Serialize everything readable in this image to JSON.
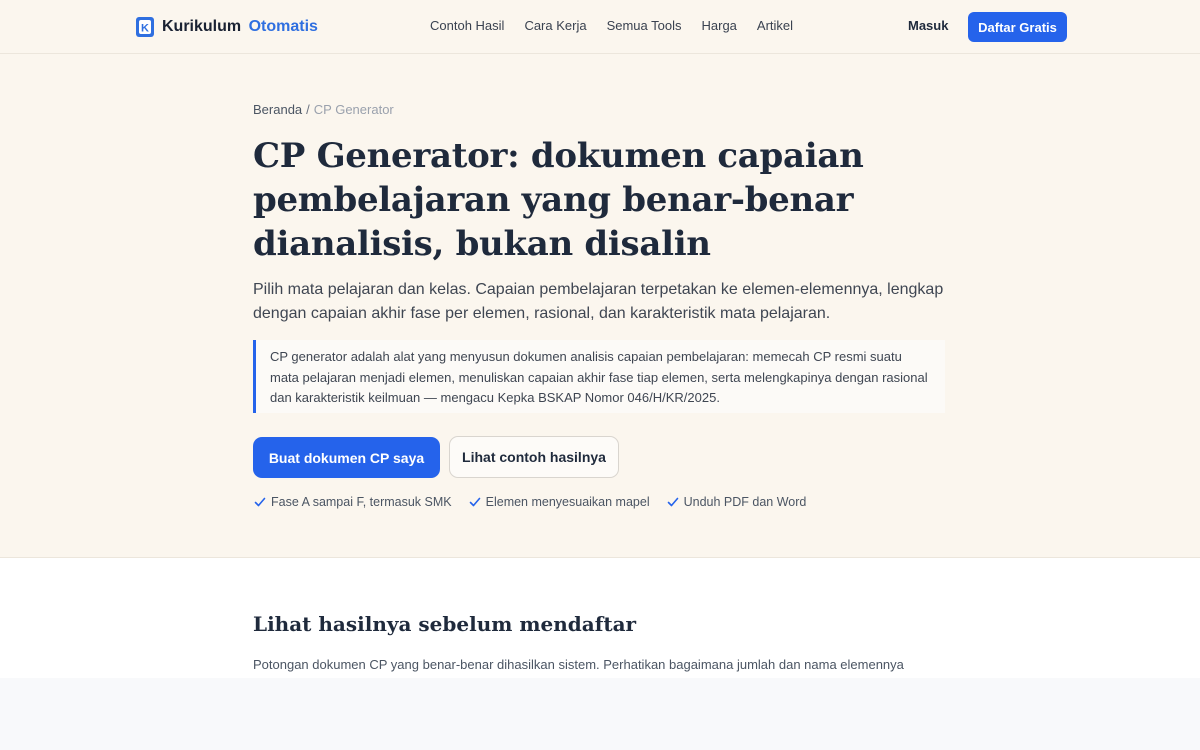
{
  "brand": {
    "name_part1": "Kurikulum",
    "name_part2": "Otomatis",
    "logo_letter": "K",
    "accent_color": "#2563eb"
  },
  "nav": {
    "links": [
      "Contoh Hasil",
      "Cara Kerja",
      "Semua Tools",
      "Harga",
      "Artikel"
    ],
    "login_label": "Masuk",
    "signup_label": "Daftar Gratis"
  },
  "breadcrumb": {
    "home": "Beranda",
    "separator": "/",
    "current": "CP Generator"
  },
  "hero": {
    "title": "CP Generator: dokumen capaian pembelajaran yang benar-benar dianalisis, bukan disalin",
    "subtitle": "Pilih mata pelajaran dan kelas. Capaian pembelajaran terpetakan ke elemen-elemennya, lengkap dengan capaian akhir fase per elemen, rasional, dan karakteristik mata pelajaran.",
    "callout": "CP generator adalah alat yang menyusun dokumen analisis capaian pembelajaran: memecah CP resmi suatu mata pelajaran menjadi elemen, menuliskan capaian akhir fase tiap elemen, serta melengkapinya dengan rasional dan karakteristik keilmuan — mengacu Kepka BSKAP Nomor 046/H/KR/2025.",
    "primary_button": "Buat dokumen CP saya",
    "secondary_button": "Lihat contoh hasilnya",
    "features": [
      "Fase A sampai F, termasuk SMK",
      "Elemen menyesuaikan mapel",
      "Unduh PDF dan Word"
    ],
    "feature_icon": "check-icon"
  },
  "preview_section": {
    "title": "Lihat hasilnya sebelum mendaftar",
    "description": "Potongan dokumen CP yang benar-benar dihasilkan sistem. Perhatikan bagaimana jumlah dan nama elemennya"
  }
}
